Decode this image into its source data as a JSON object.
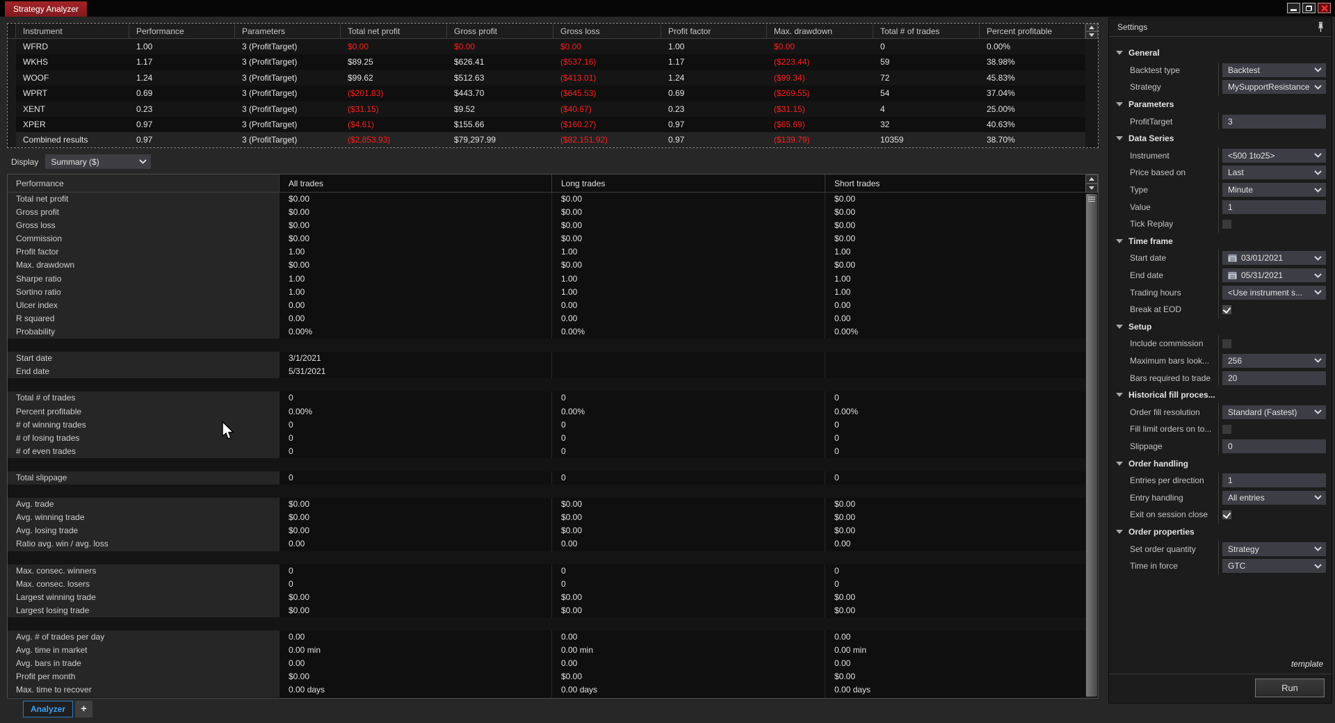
{
  "window": {
    "title": "Strategy Analyzer"
  },
  "results_grid": {
    "columns": [
      "Instrument",
      "Performance",
      "Parameters",
      "Total net profit",
      "Gross profit",
      "Gross loss",
      "Profit factor",
      "Max. drawdown",
      "Total # of trades",
      "Percent profitable"
    ],
    "rows": [
      {
        "cells": [
          "WFRD",
          "1.00",
          "3 (ProfitTarget)",
          "$0.00",
          "$0.00",
          "$0.00",
          "1.00",
          "$0.00",
          "0",
          "0.00%"
        ],
        "red": [
          3,
          4,
          5,
          7
        ],
        "highlight": false
      },
      {
        "cells": [
          "WKHS",
          "1.17",
          "3 (ProfitTarget)",
          "$89.25",
          "$626.41",
          "($537.16)",
          "1.17",
          "($223.44)",
          "59",
          "38.98%"
        ],
        "red": [
          5,
          7
        ],
        "highlight": false
      },
      {
        "cells": [
          "WOOF",
          "1.24",
          "3 (ProfitTarget)",
          "$99.62",
          "$512.63",
          "($413.01)",
          "1.24",
          "($99.34)",
          "72",
          "45.83%"
        ],
        "red": [
          5,
          7
        ],
        "highlight": false
      },
      {
        "cells": [
          "WPRT",
          "0.69",
          "3 (ProfitTarget)",
          "($201.83)",
          "$443.70",
          "($645.53)",
          "0.69",
          "($269.55)",
          "54",
          "37.04%"
        ],
        "red": [
          3,
          5,
          7
        ],
        "highlight": false
      },
      {
        "cells": [
          "XENT",
          "0.23",
          "3 (ProfitTarget)",
          "($31.15)",
          "$9.52",
          "($40.67)",
          "0.23",
          "($31.15)",
          "4",
          "25.00%"
        ],
        "red": [
          3,
          5,
          7
        ],
        "highlight": false
      },
      {
        "cells": [
          "XPER",
          "0.97",
          "3 (ProfitTarget)",
          "($4.61)",
          "$155.66",
          "($160.27)",
          "0.97",
          "($65.69)",
          "32",
          "40.63%"
        ],
        "red": [
          3,
          5,
          7
        ],
        "highlight": false
      },
      {
        "cells": [
          "Combined results",
          "0.97",
          "3 (ProfitTarget)",
          "($2,853.93)",
          "$79,297.99",
          "($82,151.92)",
          "0.97",
          "($139.79)",
          "10359",
          "38.70%"
        ],
        "red": [
          3,
          5,
          7
        ],
        "highlight": true
      }
    ]
  },
  "display": {
    "label": "Display",
    "value": "Summary ($)"
  },
  "performance_grid": {
    "columns": [
      "Performance",
      "All trades",
      "Long trades",
      "Short trades"
    ],
    "rows": [
      [
        "Total net profit",
        "$0.00",
        "$0.00",
        "$0.00"
      ],
      [
        "Gross profit",
        "$0.00",
        "$0.00",
        "$0.00"
      ],
      [
        "Gross loss",
        "$0.00",
        "$0.00",
        "$0.00"
      ],
      [
        "Commission",
        "$0.00",
        "$0.00",
        "$0.00"
      ],
      [
        "Profit factor",
        "1.00",
        "1.00",
        "1.00"
      ],
      [
        "Max. drawdown",
        "$0.00",
        "$0.00",
        "$0.00"
      ],
      [
        "Sharpe ratio",
        "1.00",
        "1.00",
        "1.00"
      ],
      [
        "Sortino ratio",
        "1.00",
        "1.00",
        "1.00"
      ],
      [
        "Ulcer index",
        "0.00",
        "0.00",
        "0.00"
      ],
      [
        "R squared",
        "0.00",
        "0.00",
        "0.00"
      ],
      [
        "Probability",
        "0.00%",
        "0.00%",
        "0.00%"
      ],
      [
        "",
        "",
        "",
        ""
      ],
      [
        "Start date",
        "3/1/2021",
        "",
        ""
      ],
      [
        "End date",
        "5/31/2021",
        "",
        ""
      ],
      [
        "",
        "",
        "",
        ""
      ],
      [
        "Total # of trades",
        "0",
        "0",
        "0"
      ],
      [
        "Percent profitable",
        "0.00%",
        "0.00%",
        "0.00%"
      ],
      [
        "# of winning trades",
        "0",
        "0",
        "0"
      ],
      [
        "# of losing trades",
        "0",
        "0",
        "0"
      ],
      [
        "# of even trades",
        "0",
        "0",
        "0"
      ],
      [
        "",
        "",
        "",
        ""
      ],
      [
        "Total slippage",
        "0",
        "0",
        "0"
      ],
      [
        "",
        "",
        "",
        ""
      ],
      [
        "Avg. trade",
        "$0.00",
        "$0.00",
        "$0.00"
      ],
      [
        "Avg. winning trade",
        "$0.00",
        "$0.00",
        "$0.00"
      ],
      [
        "Avg. losing trade",
        "$0.00",
        "$0.00",
        "$0.00"
      ],
      [
        "Ratio avg. win / avg. loss",
        "0.00",
        "0.00",
        "0.00"
      ],
      [
        "",
        "",
        "",
        ""
      ],
      [
        "Max. consec. winners",
        "0",
        "0",
        "0"
      ],
      [
        "Max. consec. losers",
        "0",
        "0",
        "0"
      ],
      [
        "Largest winning trade",
        "$0.00",
        "$0.00",
        "$0.00"
      ],
      [
        "Largest losing trade",
        "$0.00",
        "$0.00",
        "$0.00"
      ],
      [
        "",
        "",
        "",
        ""
      ],
      [
        "Avg. # of trades per day",
        "0.00",
        "0.00",
        "0.00"
      ],
      [
        "Avg. time in market",
        "0.00 min",
        "0.00 min",
        "0.00 min"
      ],
      [
        "Avg. bars in trade",
        "0.00",
        "0.00",
        "0.00"
      ],
      [
        "Profit per month",
        "$0.00",
        "$0.00",
        "$0.00"
      ],
      [
        "Max. time to recover",
        "0.00 days",
        "0.00 days",
        "0.00 days"
      ]
    ]
  },
  "tabs": {
    "items": [
      "Analyzer"
    ],
    "add_label": "+"
  },
  "settings": {
    "title": "Settings",
    "template_label": "template",
    "run_label": "Run",
    "sections": [
      {
        "header": "General",
        "rows": [
          {
            "label": "Backtest type",
            "type": "select",
            "value": "Backtest"
          },
          {
            "label": "Strategy",
            "type": "select",
            "value": "MySupportResistance"
          }
        ]
      },
      {
        "header": "Parameters",
        "rows": [
          {
            "label": "ProfitTarget",
            "type": "input",
            "value": "3"
          }
        ]
      },
      {
        "header": "Data Series",
        "rows": [
          {
            "label": "Instrument",
            "type": "select",
            "value": "<500 1to25>"
          },
          {
            "label": "Price based on",
            "type": "select",
            "value": "Last"
          },
          {
            "label": "Type",
            "type": "select",
            "value": "Minute"
          },
          {
            "label": "Value",
            "type": "input",
            "value": "1"
          },
          {
            "label": "Tick Replay",
            "type": "checkbox",
            "checked": false
          }
        ]
      },
      {
        "header": "Time frame",
        "rows": [
          {
            "label": "Start date",
            "type": "date",
            "value": "03/01/2021"
          },
          {
            "label": "End date",
            "type": "date",
            "value": "05/31/2021"
          },
          {
            "label": "Trading hours",
            "type": "select",
            "value": "<Use instrument s..."
          },
          {
            "label": "Break at EOD",
            "type": "checkbox",
            "checked": true
          }
        ]
      },
      {
        "header": "Setup",
        "rows": [
          {
            "label": "Include commission",
            "type": "checkbox",
            "checked": false
          },
          {
            "label": "Maximum bars look...",
            "type": "select",
            "value": "256"
          },
          {
            "label": "Bars required to trade",
            "type": "input",
            "value": "20"
          }
        ]
      },
      {
        "header": "Historical fill proces...",
        "rows": [
          {
            "label": "Order fill resolution",
            "type": "select",
            "value": "Standard (Fastest)"
          },
          {
            "label": "Fill limit orders on to...",
            "type": "checkbox",
            "checked": false
          },
          {
            "label": "Slippage",
            "type": "input",
            "value": "0"
          }
        ]
      },
      {
        "header": "Order handling",
        "rows": [
          {
            "label": "Entries per direction",
            "type": "input",
            "value": "1"
          },
          {
            "label": "Entry handling",
            "type": "select",
            "value": "All entries"
          },
          {
            "label": "Exit on session close",
            "type": "checkbox",
            "checked": true
          }
        ]
      },
      {
        "header": "Order properties",
        "rows": [
          {
            "label": "Set order quantity",
            "type": "select",
            "value": "Strategy"
          },
          {
            "label": "Time in force",
            "type": "select",
            "value": "GTC"
          }
        ]
      }
    ]
  }
}
